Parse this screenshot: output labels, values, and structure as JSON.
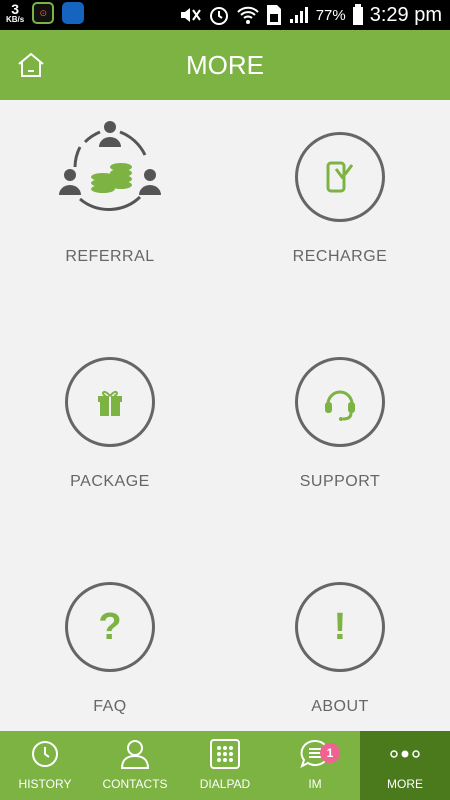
{
  "status_bar": {
    "speed_value": "3",
    "speed_unit": "KB/s",
    "battery": "77%",
    "time": "3:29 pm"
  },
  "header": {
    "title": "MORE"
  },
  "menu": [
    {
      "label": "REFERRAL",
      "icon": "referral-icon"
    },
    {
      "label": "RECHARGE",
      "icon": "phone-recharge-icon"
    },
    {
      "label": "PACKAGE",
      "icon": "gift-icon"
    },
    {
      "label": "SUPPORT",
      "icon": "headset-icon"
    },
    {
      "label": "FAQ",
      "icon": "question-icon"
    },
    {
      "label": "ABOUT",
      "icon": "exclamation-icon"
    }
  ],
  "glyphs": {
    "faq": "?",
    "about": "!"
  },
  "bottom_nav": [
    {
      "label": "HISTORY",
      "icon": "clock-icon"
    },
    {
      "label": "CONTACTS",
      "icon": "person-icon"
    },
    {
      "label": "DIALPAD",
      "icon": "dialpad-icon"
    },
    {
      "label": "IM",
      "icon": "chat-icon",
      "badge": "1"
    },
    {
      "label": "MORE",
      "icon": "dots-icon"
    }
  ],
  "colors": {
    "brand": "#7cb342",
    "active_tab": "#4a7a1c",
    "badge": "#f06292"
  }
}
